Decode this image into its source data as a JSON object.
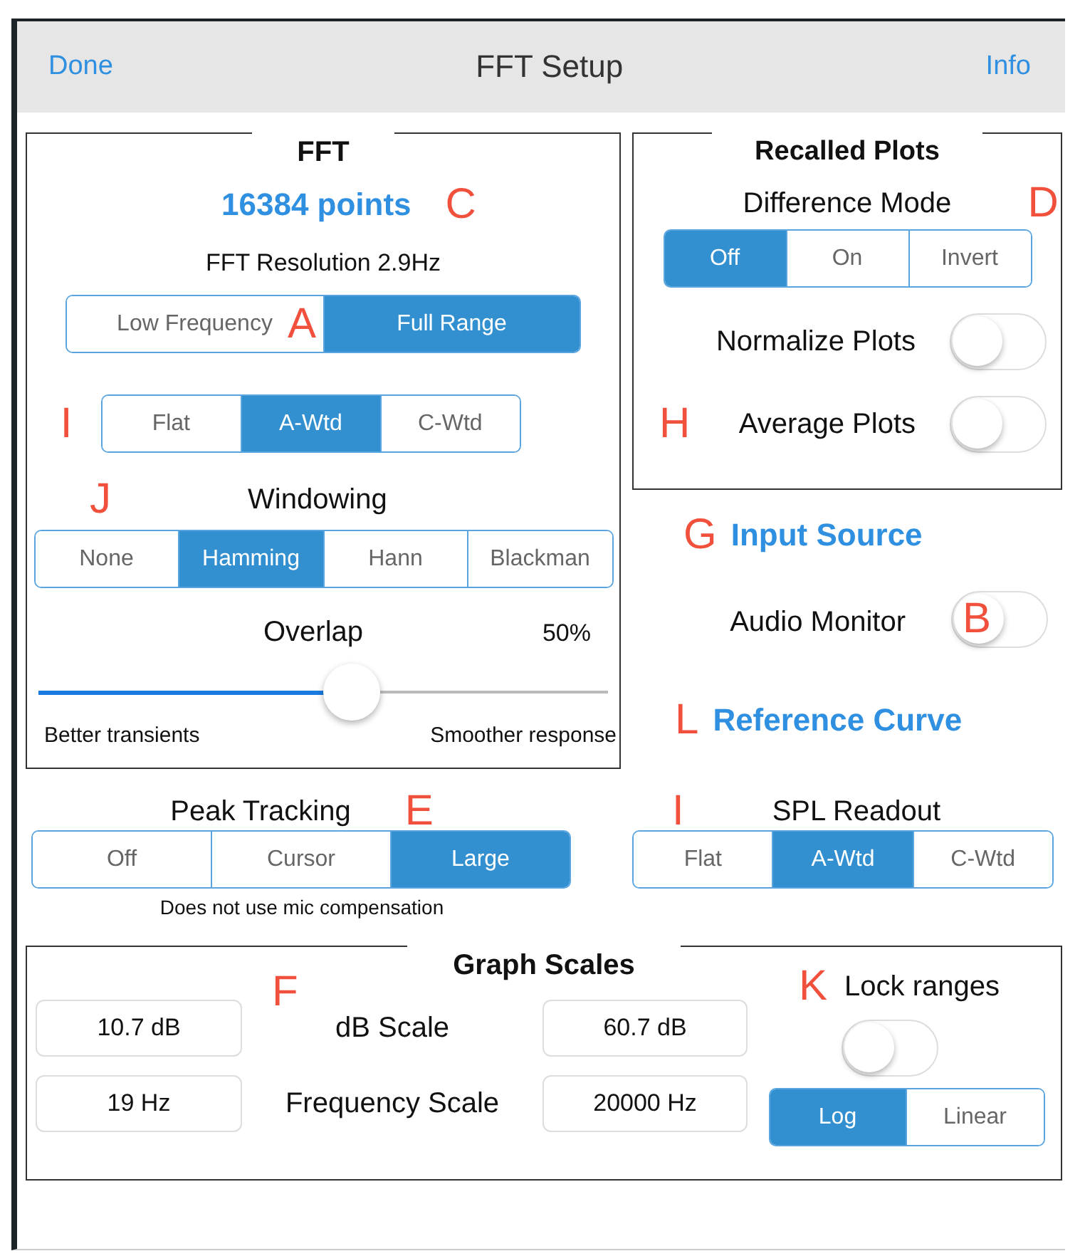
{
  "header": {
    "left_button": "Done",
    "title": "FFT Setup",
    "right_button": "Info"
  },
  "fft": {
    "title": "FFT",
    "points": "16384 points",
    "points_marker": "C",
    "resolution": "FFT Resolution 2.9Hz",
    "range": {
      "marker": "A",
      "options": [
        {
          "label": "Low Frequency",
          "selected": false
        },
        {
          "label": "Full Range",
          "selected": true
        }
      ]
    },
    "weighting": {
      "marker": "I",
      "options": [
        {
          "label": "Flat",
          "selected": false
        },
        {
          "label": "A-Wtd",
          "selected": true
        },
        {
          "label": "C-Wtd",
          "selected": false
        }
      ]
    },
    "windowing": {
      "marker": "J",
      "label": "Windowing",
      "options": [
        {
          "label": "None",
          "selected": false
        },
        {
          "label": "Hamming",
          "selected": true
        },
        {
          "label": "Hann",
          "selected": false
        },
        {
          "label": "Blackman",
          "selected": false
        }
      ]
    },
    "overlap": {
      "label": "Overlap",
      "reading": "50%",
      "level": 0.55,
      "min_label": "Better transients",
      "max_label": "Smoother response"
    }
  },
  "recalled_plots": {
    "title": "Recalled Plots",
    "marker": "D",
    "difference_mode": {
      "label": "Difference Mode",
      "options": [
        {
          "label": "Off",
          "selected": true
        },
        {
          "label": "On",
          "selected": false
        },
        {
          "label": "Invert",
          "selected": false
        }
      ]
    },
    "toggles": [
      {
        "label": "Normalize Plots",
        "on": false
      },
      {
        "marker": "H",
        "label": "Average Plots",
        "on": false
      }
    ]
  },
  "input_source": {
    "marker": "G",
    "title": "Input Source",
    "audio_monitor": {
      "label": "Audio Monitor",
      "on": false,
      "marker": "B"
    }
  },
  "reference_curve": {
    "marker": "L",
    "title": "Reference Curve"
  },
  "peak_tracking": {
    "label": "Peak Tracking",
    "marker": "E",
    "options": [
      {
        "label": "Off",
        "selected": false
      },
      {
        "label": "Cursor",
        "selected": false
      },
      {
        "label": "Large",
        "selected": true
      }
    ],
    "note": "Does not use mic compensation"
  },
  "spl_readout": {
    "marker": "I",
    "label": "SPL Readout",
    "options": [
      {
        "label": "Flat",
        "selected": false
      },
      {
        "label": "A-Wtd",
        "selected": true
      },
      {
        "label": "C-Wtd",
        "selected": false
      }
    ]
  },
  "graph_scales": {
    "title": "Graph Scales",
    "marker": "F",
    "rows": [
      {
        "min": "10.7 dB",
        "label": "dB Scale",
        "max": "60.7 dB"
      },
      {
        "min": "19 Hz",
        "label": "Frequency Scale",
        "max": "20000 Hz"
      }
    ],
    "lock": {
      "marker": "K",
      "label": "Lock ranges",
      "on": false
    },
    "axis": {
      "options": [
        {
          "label": "Log",
          "selected": true
        },
        {
          "label": "Linear",
          "selected": false
        }
      ]
    }
  }
}
